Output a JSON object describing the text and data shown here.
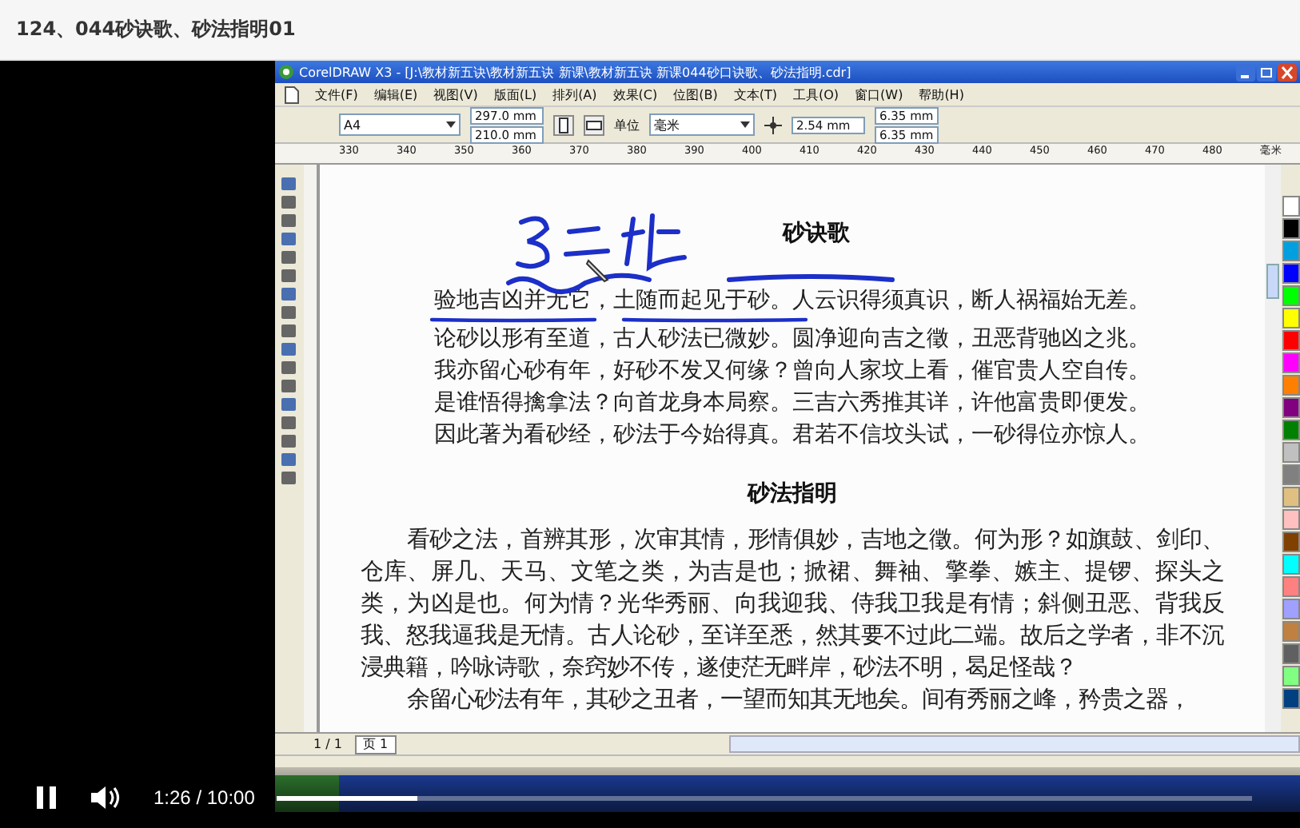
{
  "page_title": "124、044砂诀歌、砂法指明01",
  "app_window": {
    "title": "CorelDRAW X3 - [J:\\教材新五诀\\教材新五诀 新课\\教材新五诀 新课044砂口诀歌、砂法指明.cdr]",
    "menu": [
      "文件(F)",
      "编辑(E)",
      "视图(V)",
      "版面(L)",
      "排列(A)",
      "效果(C)",
      "位图(B)",
      "文本(T)",
      "工具(O)",
      "窗口(W)",
      "帮助(H)"
    ],
    "property_bar": {
      "paper_size": "A4",
      "width": "297.0 mm",
      "height": "210.0 mm",
      "units_label": "单位",
      "units": "毫米",
      "nudge": "2.54 mm",
      "duplicate_x": "6.35 mm",
      "duplicate_y": "6.35 mm"
    },
    "ruler": [
      "330",
      "340",
      "350",
      "360",
      "370",
      "380",
      "390",
      "400",
      "410",
      "420",
      "430",
      "440",
      "450",
      "460",
      "470",
      "480"
    ],
    "ruler_unit": "毫米",
    "document": {
      "title_1": "砂诀歌",
      "poem": [
        "验地吉凶并无它，土随而起见于砂。人云识得须真识，断人祸福始无差。",
        "论砂以形有至道，古人砂法已微妙。圆净迎向吉之徵，丑恶背驰凶之兆。",
        "我亦留心砂有年，好砂不发又何缘？曾向人家坟上看，催官贵人空自传。",
        "是谁悟得擒拿法？向首龙身本局察。三吉六秀推其详，许他富贵即便发。",
        "因此著为看砂经，砂法于今始得真。君若不信坟头试，一砂得位亦惊人。"
      ],
      "title_2": "砂法指明",
      "paragraphs": [
        "看砂之法，首辨其形，次审其情，形情俱妙，吉地之徵。何为形？如旗鼓、剑印、仓库、屏几、天马、文笔之类，为吉是也；掀裙、舞袖、擎拳、嫉主、提锣、探头之类，为凶是也。何为情？光华秀丽、向我迎我、侍我卫我是有情；斜侧丑恶、背我反我、怒我逼我是无情。古人论砂，至详至悉，然其要不过此二端。故后之学者，非不沉浸典籍，吟咏诗歌，奈窍妙不传，遂使茫无畔岸，砂法不明，曷足怪哉？",
        "余留心砂法有年，其砂之丑者，一望而知其无地矣。间有秀丽之峰，矜贵之器，"
      ]
    },
    "page_nav": {
      "count": "1 / 1",
      "tab": "页 1"
    }
  },
  "player": {
    "playing": true,
    "time": "1:26 / 10:00",
    "level": 0.143
  }
}
